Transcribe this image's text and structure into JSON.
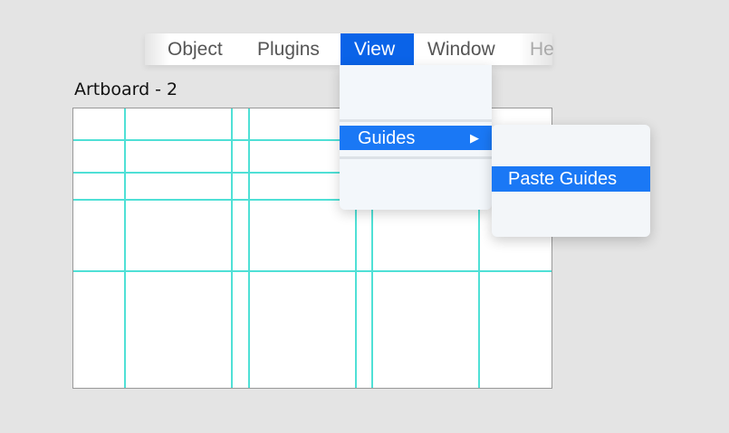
{
  "menubar": {
    "items": [
      {
        "label": "Object"
      },
      {
        "label": "Plugins"
      },
      {
        "label": "View"
      },
      {
        "label": "Window"
      },
      {
        "label": "He"
      }
    ]
  },
  "artboard": {
    "title": "Artboard - 2"
  },
  "view_menu": {
    "guides_label": "Guides",
    "submenu_arrow": "▶"
  },
  "guides_submenu": {
    "paste_label": "Paste Guides"
  },
  "colors": {
    "accent": "#0a63e8",
    "highlight": "#1a78f5",
    "guide": "#4fe0d6"
  }
}
